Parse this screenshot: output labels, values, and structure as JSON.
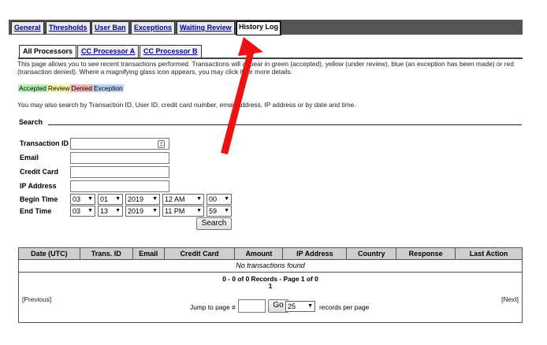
{
  "top_tabs": [
    {
      "label": "General",
      "active": false
    },
    {
      "label": "Thresholds",
      "active": false
    },
    {
      "label": "User Ban",
      "active": false
    },
    {
      "label": "Exceptions",
      "active": false
    },
    {
      "label": "Waiting Review",
      "active": false
    },
    {
      "label": "History Log",
      "active": true
    }
  ],
  "sub_tabs": [
    {
      "label": "All Processors",
      "active": true
    },
    {
      "label": "CC Processor A",
      "active": false
    },
    {
      "label": "CC Processor B",
      "active": false
    }
  ],
  "description": "This page allows you to see recent transactions performed. Transactions will appear in green (accepted), yellow (under review), blue (an exception has been made) or red (transaction denied). Where a magnifying glass icon appears, you may click it for more details.",
  "legend": {
    "accepted": "Accepted",
    "review": "Review",
    "denied": "Denied",
    "exception": "Exception"
  },
  "search_note": "You may also search by Transaction ID, User ID, credit card number, email address, IP address or by date and time.",
  "search_header": "Search",
  "fields": {
    "transaction_id": "Transaction ID",
    "email": "Email",
    "credit_card": "Credit Card",
    "ip_address": "IP Address",
    "begin_time": "Begin Time",
    "end_time": "End Time"
  },
  "begin": {
    "month": "03",
    "day": "01",
    "year": "2019",
    "hour": "12 AM",
    "minute": "00"
  },
  "end": {
    "month": "03",
    "day": "13",
    "year": "2019",
    "hour": "11 PM",
    "minute": "59"
  },
  "search_button": "Search",
  "columns": [
    "Date (UTC)",
    "Trans. ID",
    "Email",
    "Credit Card",
    "Amount",
    "IP Address",
    "Country",
    "Response",
    "Last Action"
  ],
  "no_results": "No transactions found",
  "records_line1": "0 - 0 of 0 Records - Page 1 of 0",
  "records_line2": "1",
  "previous": "[Previous]",
  "next": "[Next]",
  "jump_label": "Jump to page #",
  "go_button": "Go",
  "per_page_value": "25",
  "per_page_label": "records per page",
  "colors": {
    "tab_bar": "#555555",
    "link": "#00008b",
    "arrow": "#ee1111",
    "header_bg": "#cfcfcf"
  }
}
